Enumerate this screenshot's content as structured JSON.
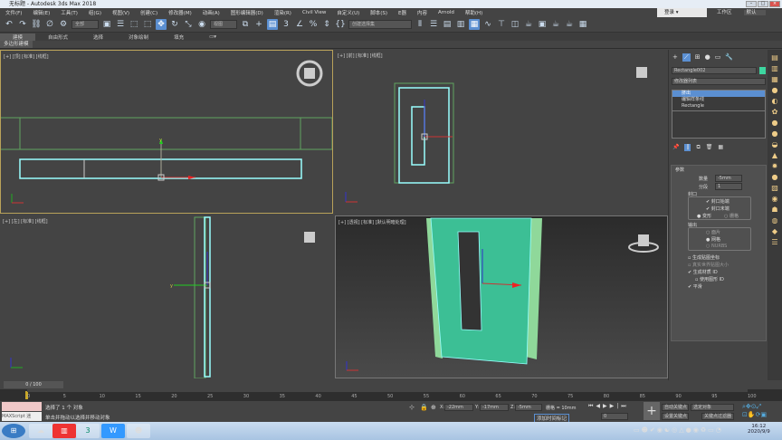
{
  "title": "无标题 - Autodesk 3ds Max 2018",
  "menu": [
    "文件(F)",
    "编辑(E)",
    "工具(T)",
    "组(G)",
    "视图(V)",
    "创建(C)",
    "修改器(M)",
    "动画(A)",
    "图形编辑器(D)",
    "渲染(R)",
    "Civil View",
    "自定义(U)",
    "脚本(S)",
    "E器",
    "内容",
    "Arnold",
    "帮助(H)"
  ],
  "login": "登录",
  "workspace_label": "工作区",
  "workspace_value": "默认",
  "toolbar": {
    "filter": "全部",
    "ref_coord": "视图",
    "selection_set": "创建选择集"
  },
  "ribbon": {
    "tabs": [
      "建模",
      "自由形式",
      "选择",
      "对象绘制",
      "填充"
    ],
    "sub": "多边形建模"
  },
  "viewports": {
    "top": "[+] [顶] [标准] [线框]",
    "front": "[+] [前] [标准] [线框]",
    "left": "[+] [左] [标准] [线框]",
    "persp": "[+] [透视] [标准] [默认明暗处理]"
  },
  "panel": {
    "object_name": "Rectangle002",
    "object_color": "#3dd6a0",
    "modifier_list": "修改器列表",
    "stack": [
      "挤出",
      "编辑样条线",
      "Rectangle"
    ],
    "rollout": "参数",
    "amount_label": "数量",
    "amount": "-5mm",
    "segments_label": "分段",
    "segments": "1",
    "cap_group": "封口",
    "cap_start": "封口始端",
    "cap_end": "封口末端",
    "morph": "变形",
    "grid": "栅格",
    "output_group": "输出",
    "patch": "面片",
    "mesh": "网格",
    "nurbs": "NURBS",
    "gen_map": "生成贴图坐标",
    "real_world": "真实世界贴图大小",
    "gen_mat": "生成材质 ID",
    "use_shape": "使用图形 ID",
    "smooth": "平滑"
  },
  "timeline": {
    "frame": "0 / 100",
    "ticks": [
      "0",
      "5",
      "10",
      "15",
      "20",
      "25",
      "30",
      "35",
      "40",
      "45",
      "50",
      "55",
      "60",
      "65",
      "70",
      "75",
      "80",
      "85",
      "90",
      "95",
      "100"
    ]
  },
  "status": {
    "maxscript": "MAXScript 迷",
    "selected": "选择了 1 个 对象",
    "hint": "单击并拖动以选择并移动对象",
    "x_label": "X:",
    "x": "-22mm",
    "y_label": "Y:",
    "y": "-17mm",
    "z_label": "Z:",
    "z": "-5mm",
    "grid": "栅格 = 10mm",
    "add_tag": "添加时间标记",
    "frame": "0",
    "auto_key": "自动关键点",
    "set_key": "设置关键点",
    "sel_obj": "选定对象",
    "key_filter": "关键点过滤器"
  },
  "clock": {
    "time": "16:12",
    "date": "2020/9/9"
  }
}
